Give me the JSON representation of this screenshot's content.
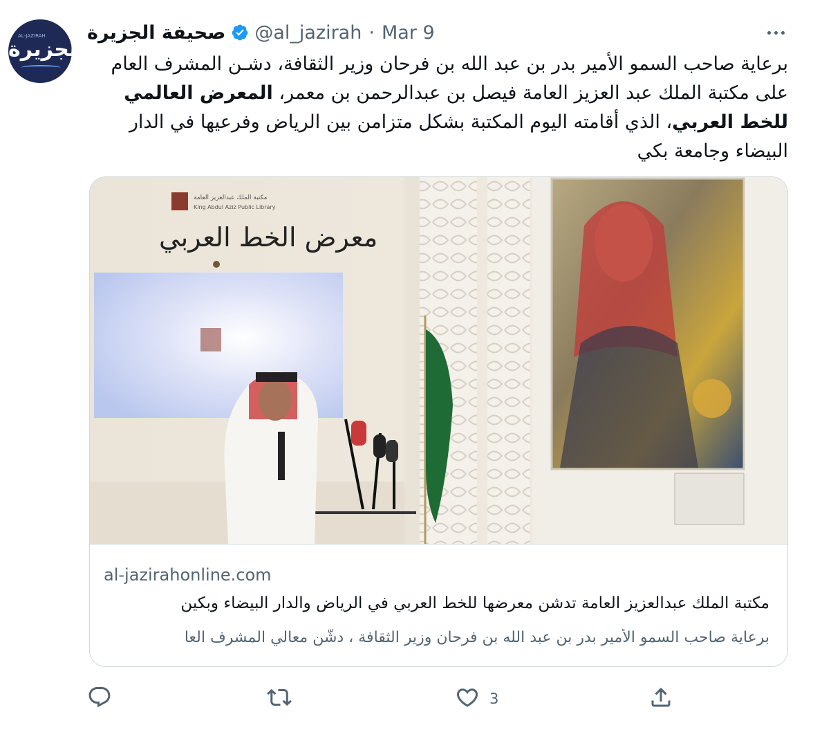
{
  "tweet": {
    "display_name": "صحيفة الجزيرة",
    "handle": "@al_jazirah",
    "separator": "·",
    "date": "Mar 9",
    "avatar_text": "الجزيرة",
    "avatar_small_text": "AL-JAZIRAH",
    "text_part1": "برعاية صاحب السمو الأمير بدر بن عبد الله بن فرحان وزير الثقافة، دشـن المشرف العام على مكتبة الملك عبد العزيز العامة فيصل بن عبدالرحمن بن معمر، ",
    "text_bold": "المعرض العالمي للخط العربي",
    "text_part2": "، الذي أقامته اليوم المكتبة بشكل متزامن بين الرياض وفرعيها في الدار البيضاء وجامعة بكي"
  },
  "card": {
    "domain": "al-jazirahonline.com",
    "title": "مكتبة الملك عبدالعزيز العامة تدشن معرضها للخط العربي في الرياض والدار البيضاء وبكين",
    "description": "برعاية صاحب السمو الأمير بدر بن عبد الله بن فرحان وزير الثقافة ، دشَّن معالي المشرف العا",
    "photo": {
      "library_name_ar": "مكتبة الملك عبدالعزيز العامة",
      "library_name_en": "King Abdul Aziz Public Library",
      "exhibition_title": "معرض الخط العربي"
    }
  },
  "actions": {
    "reply_count": "",
    "retweet_count": "",
    "like_count": "3",
    "share_count": ""
  },
  "colors": {
    "text_primary": "#0f1419",
    "text_secondary": "#536471",
    "verified_blue": "#1d9bf0",
    "border": "#cfd9de",
    "avatar_bg": "#1e2a55"
  },
  "icons": [
    "verified-badge-icon",
    "more-icon",
    "reply-icon",
    "retweet-icon",
    "like-icon",
    "share-icon"
  ]
}
